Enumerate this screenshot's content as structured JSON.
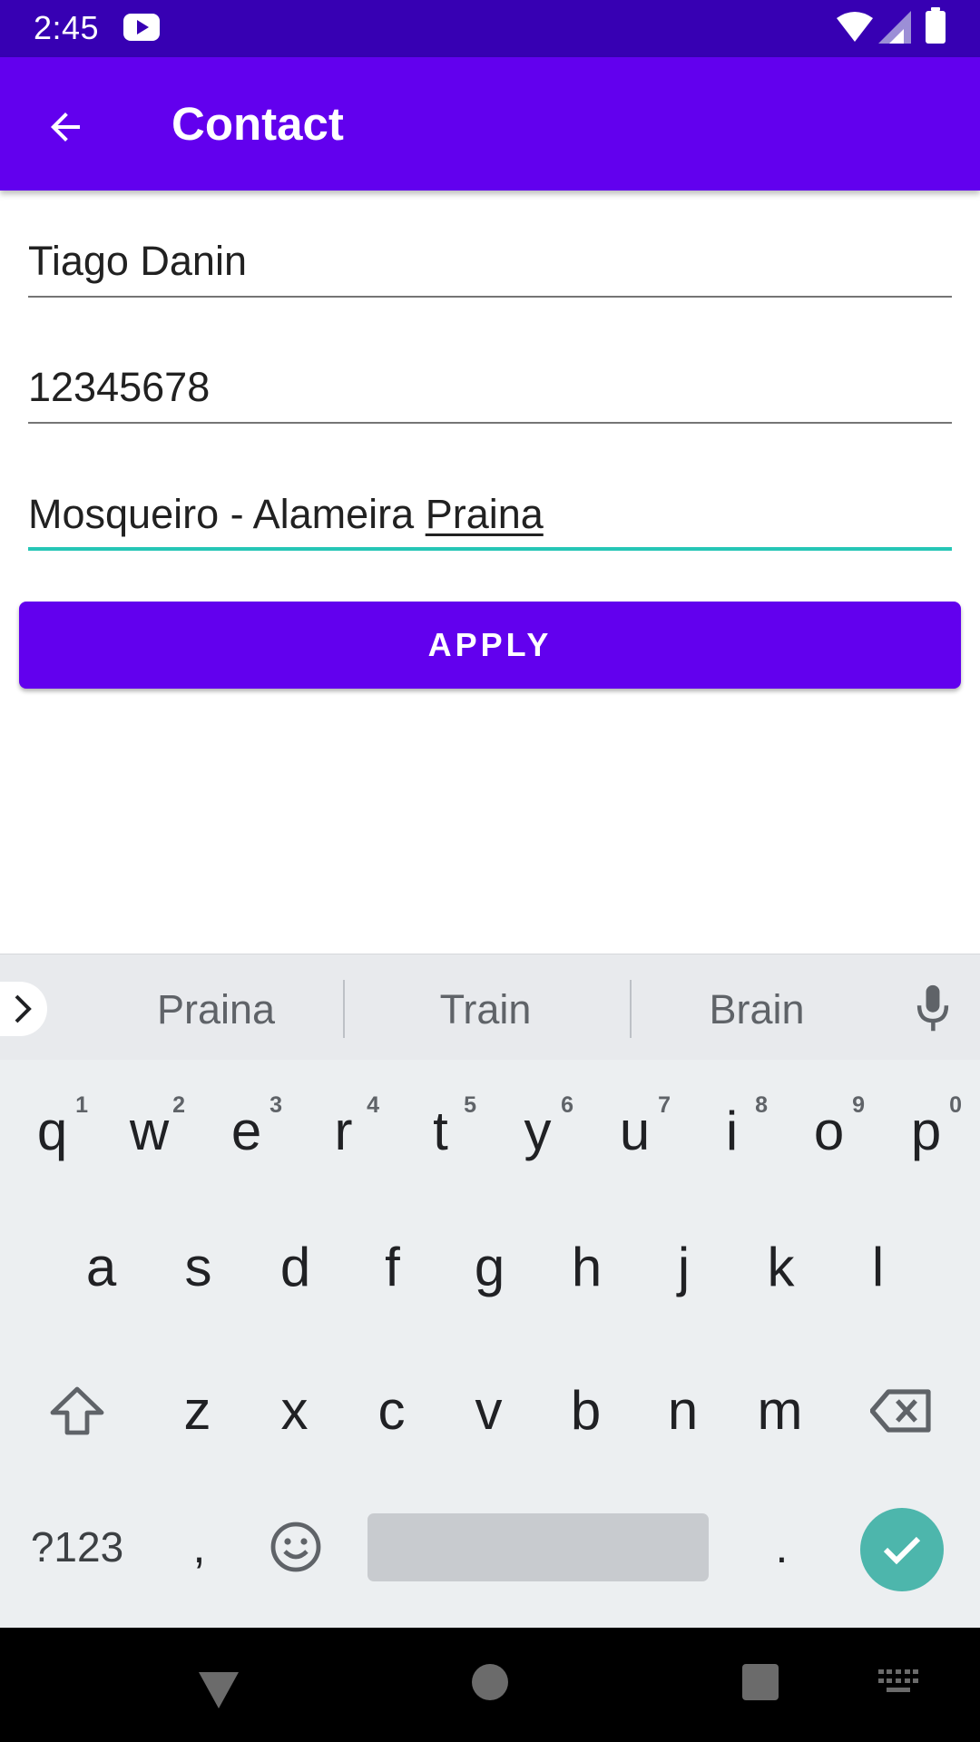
{
  "status_bar": {
    "time": "2:45",
    "icons": [
      "youtube-icon",
      "wifi-icon",
      "signal-icon",
      "battery-icon"
    ]
  },
  "app_bar": {
    "title": "Contact",
    "back_icon": "arrow-back-icon"
  },
  "form": {
    "name_value": "Tiago Danin",
    "phone_value": "12345678",
    "address_value_prefix": "Mosqueiro - Alameira ",
    "address_value_composing": "Praina",
    "apply_label": "APPLY"
  },
  "keyboard": {
    "suggestions": [
      "Praina",
      "Train",
      "Brain"
    ],
    "row1": [
      {
        "key": "q",
        "hint": "1"
      },
      {
        "key": "w",
        "hint": "2"
      },
      {
        "key": "e",
        "hint": "3"
      },
      {
        "key": "r",
        "hint": "4"
      },
      {
        "key": "t",
        "hint": "5"
      },
      {
        "key": "y",
        "hint": "6"
      },
      {
        "key": "u",
        "hint": "7"
      },
      {
        "key": "i",
        "hint": "8"
      },
      {
        "key": "o",
        "hint": "9"
      },
      {
        "key": "p",
        "hint": "0"
      }
    ],
    "row2": [
      "a",
      "s",
      "d",
      "f",
      "g",
      "h",
      "j",
      "k",
      "l"
    ],
    "row3": [
      "z",
      "x",
      "c",
      "v",
      "b",
      "n",
      "m"
    ],
    "symbols_label": "?123",
    "comma_label": ",",
    "period_label": "."
  },
  "colors": {
    "status_bar": "#3700b3",
    "primary": "#6200ee",
    "accent": "#26c6b6",
    "enter": "#4db6ac"
  }
}
